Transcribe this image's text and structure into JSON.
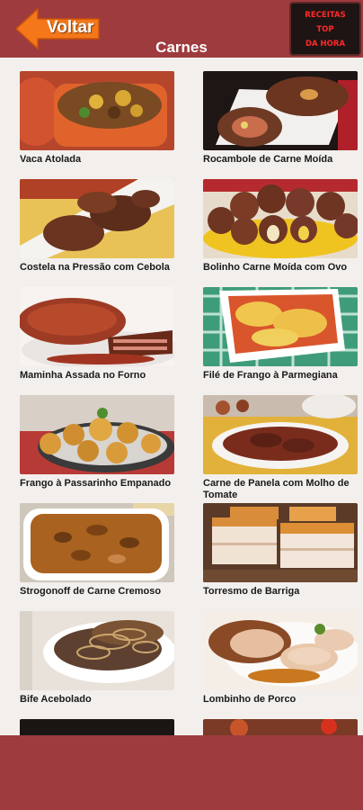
{
  "header": {
    "back_label": "Voltar",
    "title": "Carnes",
    "logo_lines": [
      "RECEITAS",
      "TOP",
      "DA HORA"
    ]
  },
  "colors": {
    "brand": "#9e3b3e",
    "back_arrow": "#f4771a",
    "background": "#f3efec",
    "logo_text": "#ff2a2a"
  },
  "recipes": [
    {
      "label": "Vaca Atolada"
    },
    {
      "label": "Rocambole de Carne Moída"
    },
    {
      "label": "Costela na Pressão com Cebola"
    },
    {
      "label": "Bolinho Carne Moída com Ovo"
    },
    {
      "label": "Maminha Assada no Forno"
    },
    {
      "label": "Filé de Frango à Parmegiana"
    },
    {
      "label": "Frango à Passarinho Empanado"
    },
    {
      "label": "Carne de Panela com Molho de Tomate"
    },
    {
      "label": "Strogonoff de Carne Cremoso"
    },
    {
      "label": "Torresmo de Barriga"
    },
    {
      "label": "Bife Acebolado"
    },
    {
      "label": "Lombinho de Porco"
    },
    {
      "label": ""
    },
    {
      "label": ""
    }
  ]
}
